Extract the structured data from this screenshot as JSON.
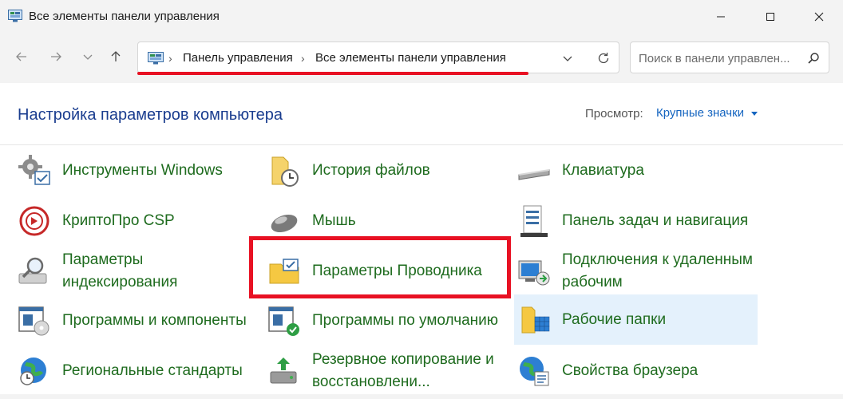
{
  "window": {
    "title": "Все элементы панели управления"
  },
  "address": {
    "crumbs": [
      "Панель управления",
      "Все элементы панели управления"
    ]
  },
  "search": {
    "placeholder": "Поиск в панели управлен..."
  },
  "header": {
    "title": "Настройка параметров компьютера",
    "view_label": "Просмотр:",
    "view_value": "Крупные значки"
  },
  "items": [
    {
      "label": "Инструменты Windows",
      "icon": "tools-icon"
    },
    {
      "label": "КриптоПро CSP",
      "icon": "cryptopro-icon"
    },
    {
      "label": "Параметры индексирования",
      "icon": "indexing-icon"
    },
    {
      "label": "Программы и компоненты",
      "icon": "programs-icon"
    },
    {
      "label": "Региональные стандарты",
      "icon": "region-icon"
    },
    {
      "label": "История файлов",
      "icon": "file-history-icon"
    },
    {
      "label": "Мышь",
      "icon": "mouse-icon"
    },
    {
      "label": "Параметры Проводника",
      "icon": "explorer-options-icon"
    },
    {
      "label": "Программы по умолчанию",
      "icon": "default-programs-icon"
    },
    {
      "label": "Резервное копирование и восстановлени...",
      "icon": "backup-icon"
    },
    {
      "label": "Клавиатура",
      "icon": "keyboard-icon"
    },
    {
      "label": "Панель задач и навигация",
      "icon": "taskbar-icon"
    },
    {
      "label": "Подключения к удаленным рабочим",
      "icon": "remote-desktop-icon"
    },
    {
      "label": "Рабочие папки",
      "icon": "work-folders-icon"
    },
    {
      "label": "Свойства браузера",
      "icon": "internet-options-icon"
    }
  ],
  "colors": {
    "link_green": "#1e6b1e",
    "heading_blue": "#1a3d8f",
    "accent_blue": "#1565c0",
    "highlight_red": "#e81123",
    "hover_bg": "#e4f1fc"
  }
}
